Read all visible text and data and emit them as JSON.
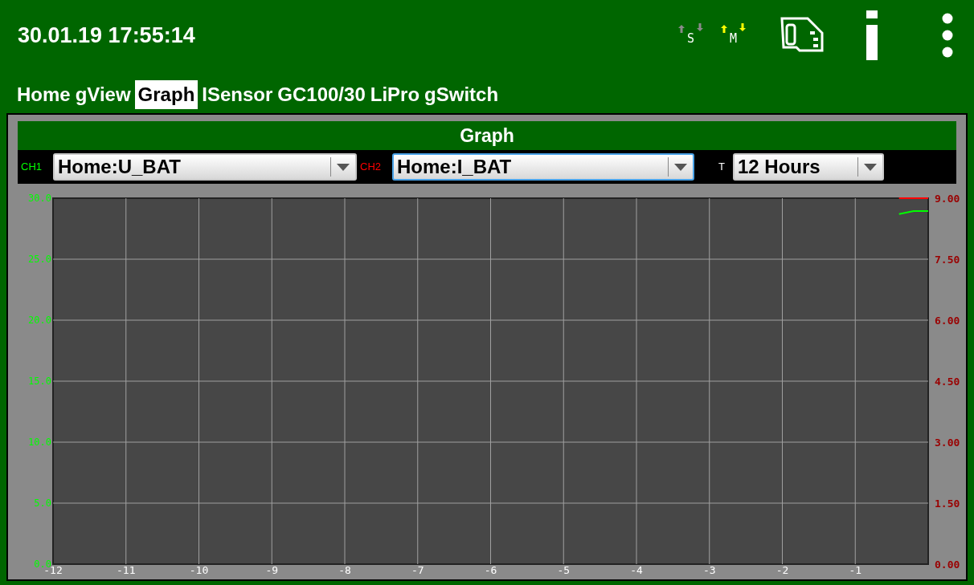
{
  "status_bar": {
    "datetime": "30.01.19 17:55:14",
    "indicators": [
      {
        "label": "S",
        "active": false
      },
      {
        "label": "M",
        "active": true
      }
    ]
  },
  "tabs": [
    {
      "label": "Home",
      "selected": false
    },
    {
      "label": "gView",
      "selected": false
    },
    {
      "label": "Graph",
      "selected": true
    },
    {
      "label": "ISensor",
      "selected": false
    },
    {
      "label": "GC100/30",
      "selected": false
    },
    {
      "label": "LiPro",
      "selected": false
    },
    {
      "label": "gSwitch",
      "selected": false
    }
  ],
  "panel": {
    "title": "Graph",
    "selectors": [
      {
        "kind": "channel",
        "value": "Home:U_BAT",
        "focused": false
      },
      {
        "kind": "channel",
        "value": "Home:I_BAT",
        "focused": true
      },
      {
        "kind": "period",
        "label": "T",
        "value": "12 Hours",
        "focused": false
      }
    ],
    "chart_data": {
      "type": "line",
      "x": [
        -0.4,
        -0.2,
        0
      ],
      "grid": true,
      "xlim": [
        -12,
        0
      ],
      "ylim": [
        0,
        30
      ],
      "y2lim": [
        0,
        9
      ],
      "xticks": [
        -12,
        -11,
        -10,
        -9,
        -8,
        -7,
        -6,
        -5,
        -4,
        -3,
        -2,
        -1
      ],
      "yticks": [
        {
          "value": 0,
          "label": "0.0"
        },
        {
          "value": 5,
          "label": "5.0"
        },
        {
          "value": 10,
          "label": "10.0"
        },
        {
          "value": 15,
          "label": "15.0"
        },
        {
          "value": 20,
          "label": "20.0"
        },
        {
          "value": 25,
          "label": "25.0"
        },
        {
          "value": 30,
          "label": "30.0"
        }
      ],
      "y2ticks": [
        {
          "value": 0,
          "label": "0.00"
        },
        {
          "value": 1.5,
          "label": "1.50"
        },
        {
          "value": 3,
          "label": "3.00"
        },
        {
          "value": 4.5,
          "label": "4.50"
        },
        {
          "value": 6,
          "label": "6.00"
        },
        {
          "value": 7.5,
          "label": "7.50"
        },
        {
          "value": 9,
          "label": "9.00"
        }
      ],
      "series": [
        {
          "name": "CH1",
          "color": "#00ff00",
          "axis": "y",
          "values": [
            28.7,
            28.95,
            28.95
          ]
        },
        {
          "name": "CH2",
          "color": "#ff0000",
          "axis": "y2",
          "values": [
            9,
            9,
            9
          ]
        }
      ]
    }
  }
}
